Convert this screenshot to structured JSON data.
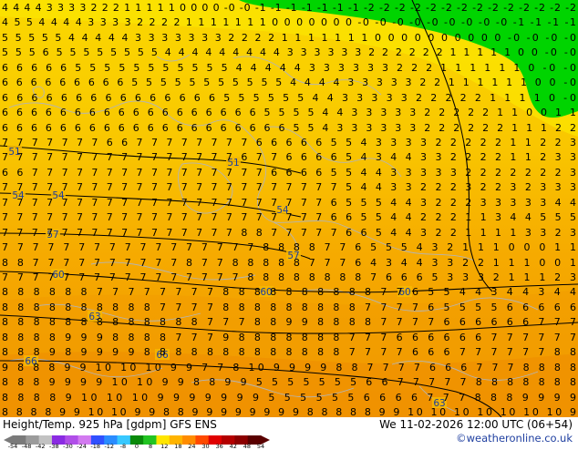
{
  "map": {
    "field": "Height/Temp. 925 hPa [gdpm] GFS ENS",
    "contour_labels": [
      "51",
      "51",
      "54",
      "54",
      "54",
      "57",
      "57",
      "60",
      "60",
      "60",
      "63",
      "63",
      "66",
      "66"
    ],
    "digit_rows": [
      "4 4 4 4 3 3 3 3 2 2 2 1 1 1 1 1 0 0 0 0 -0 -0 -1 -1 -1 -1 -1 -1 -1 -2 -2 -2 -2 -2 -2 -2 -2 -2 -2 -2 -2 -2 -2",
      "4 5 5 4 4 4 4 3 3 3 3 2 2 2 2 1 1 1 1 1 1 1 0 0 0 0 0 0 0 -0 -0 -0 -0 -0 -0 -0 -0 -0 -1 -1 -1 -1",
      "5 5 5 5 5 4 4 4 4 4 3 3 3 3 3 3 3 2 2 2 2 1 1 1 1 1 1 1 0 0 0 0 0 0 0 0 0 0 -0 -0 -0 -0",
      "5 5 5 6 5 5 5 5 5 5 5 5 4 4 4 4 4 4 4 4 4 3 3 3 3 3 3 2 2 2 2 2 2 1 1 1 1 1 0 0 -0 -0",
      "6 6 6 6 6 5 5 5 5 5 5 5 5 5 5 5 4 4 4 4 4 3 3 3 3 3 3 2 2 2 1 1 1 1 1 1 0 -0 -0",
      "6 6 6 6 6 6 6 6 6 5 5 5 5 5 5 5 5 5 5 5 4 4 4 4 3 3 3 3 3 2 2 1 1 1 1 1 1 0 0 -0",
      "6 6 6 6 6 6 6 6 6 6 6 6 6 6 6 5 5 5 5 5 5 4 4 3 3 3 3 3 2 2 2 2 2 1 1 1 1 0 -0",
      "6 6 6 6 6 6 6 6 6 6 6 6 6 6 6 6 6 6 5 5 5 5 4 4 3 3 3 3 3 2 2 2 2 2 1 1 0 0 1 1",
      "6 6 6 6 6 6 6 6 6 6 6 6 6 6 6 6 6 6 6 6 5 5 4 3 3 3 3 3 3 2 2 2 2 2 2 1 1 1 2 2",
      "7 7 7 7 7 7 7 6 6 7 7 7 7 7 7 7 7 6 6 6 6 6 5 5 4 3 3 3 3 2 2 2 2 2 1 1 2 2 3",
      "7 7 7 7 7 7 7 7 7 7 7 7 7 7 7 7 6 7 7 6 6 6 6 5 4 3 4 4 3 3 2 2 2 2 1 1 2 3 3",
      "6 6 7 7 7 7 7 7 7 7 7 7 7 7 7 7 7 7 6 6 6 6 5 5 4 4 3 3 3 3 3 2 2 2 2 2 2 2 3",
      "7 7 7 7 7 7 7 7 7 7 7 7 7 7 7 7 7 7 7 7 7 7 7 5 4 4 3 3 2 2 2 3 2 2 3 2 3 3 3",
      "7 7 7 7 7 7 7 7 7 7 7 7 7 7 7 7 7 7 7 7 7 7 6 5 5 5 4 4 3 2 2 2 3 3 3 3 3 4 4",
      "7 7 7 7 7 7 7 7 7 7 7 7 7 7 7 7 7 7 7 7 7 7 6 6 5 5 4 4 2 2 2 1 1 3 4 4 5 5 5",
      "7 7 7 7 7 7 7 7 7 7 7 7 7 7 7 7 8 8 7 7 7 7 7 6 6 5 4 4 3 2 2 1 1 1 1 3 3 2 3",
      "7 7 7 7 7 7 7 7 7 7 7 7 7 7 7 7 7 8 8 8 8 7 7 6 5 5 5 4 3 2 1 1 1 0 0 0 1 1",
      "8 8 7 7 7 7 7 7 7 7 7 7 8 7 7 8 8 8 8 8 7 7 7 6 4 3 4 4 3 3 2 2 1 1 1 0 0 1",
      "7 7 7 7 7 7 7 7 7 7 7 7 7 7 7 7 8 8 8 8 8 8 8 8 7 6 6 6 5 3 3 3 2 1 1 1 2 3",
      "8 8 8 8 8 8 7 7 7 7 7 7 7 7 8 8 8 8 8 8 8 8 8 8 7 7 6 5 5 4 4 3 4 4 3 4 4",
      "8 8 8 8 8 8 8 8 8 8 7 7 7 7 8 8 8 8 8 8 8 8 8 7 7 7 7 6 5 5 5 5 6 6 6 6 6",
      "8 8 8 8 8 8 8 8 8 8 8 8 8 7 7 7 8 8 9 9 8 8 8 8 7 7 7 7 6 6 6 6 6 6 7 7 7",
      "8 8 8 8 9 9 9 8 8 8 8 7 7 7 9 8 8 8 8 8 8 8 7 7 7 6 6 6 6 6 6 7 7 7 7 7 7",
      "8 8 8 9 8 9 9 9 9 8 8 8 8 8 8 8 8 8 8 8 8 8 7 7 7 7 6 6 6 7 7 7 7 7 7 8 8",
      "9 8 8 8 9 9 10 10 10 9 9 7 7 8 10 9 9 9 9 8 8 7 7 7 7 6 6 6 7 7 7 8 8 8 8",
      "8 8 8 9 9 9 9 10 10 9 9 8 8 9 9 5 5 5 5 5 5 5 6 6 7 7 7 7 7 8 8 8 8 8 8 8",
      "8 8 8 8 9 10 10 10 9 9 9 9 9 9 9 5 5 5 5 5 5 6 6 6 6 7 7 7 8 8 8 9 9 9 9",
      "8 8 8 8 9 9 10 10 9 9 8 8 9 9 9 9 9 9 9 9 8 8 8 8 8 9 9 10 10 10 10 10 10 10 9"
    ]
  },
  "footer": {
    "title": "Height/Temp. 925 hPa [gdpm] GFS ENS",
    "valid": "We 11-02-2026 12:00 UTC (06+54)",
    "credit": "©weatheronline.co.uk",
    "scale_ticks": [
      "-54",
      "-48",
      "-42",
      "-38",
      "-30",
      "-24",
      "-18",
      "-12",
      "-8",
      "0",
      "8",
      "12",
      "18",
      "24",
      "30",
      "36",
      "42",
      "48",
      "54"
    ],
    "scale_colors": [
      "#7a7a7a",
      "#9b9b9b",
      "#c2c2c2",
      "#8a2be2",
      "#b04ee8",
      "#d27af0",
      "#3050ff",
      "#2a8cff",
      "#38c8ff",
      "#0a8a0a",
      "#22c422",
      "#ffe500",
      "#ffb400",
      "#ff8c00",
      "#ff4a00",
      "#e00000",
      "#b40000",
      "#8c0000",
      "#5a0000"
    ]
  }
}
